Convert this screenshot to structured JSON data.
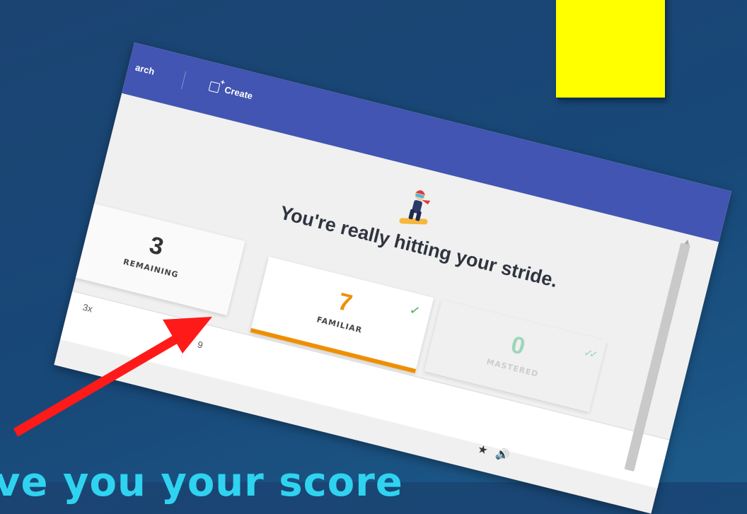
{
  "topbar": {
    "search_partial": "arch",
    "create_label": "Create"
  },
  "headline": "You're really hitting your stride.",
  "cards": [
    {
      "value": "3",
      "label": "REMAINING"
    },
    {
      "value": "7",
      "label": "FAMILIAR"
    },
    {
      "value": "0",
      "label": "MASTERED"
    }
  ],
  "row": {
    "cell1": "3x",
    "cell2": "9"
  },
  "caption": "ve you your score",
  "colors": {
    "topbar": "#4255b2",
    "familiar": "#ef8f00",
    "mastered": "#8fd3b0",
    "sticky": "#ffff00",
    "arrow": "#ff0000",
    "caption": "#2fd3f0"
  },
  "icons": [
    "create-icon",
    "snowboarder-icon",
    "check-icon",
    "double-check-icon",
    "star-icon",
    "speaker-icon",
    "red-arrow-icon"
  ]
}
